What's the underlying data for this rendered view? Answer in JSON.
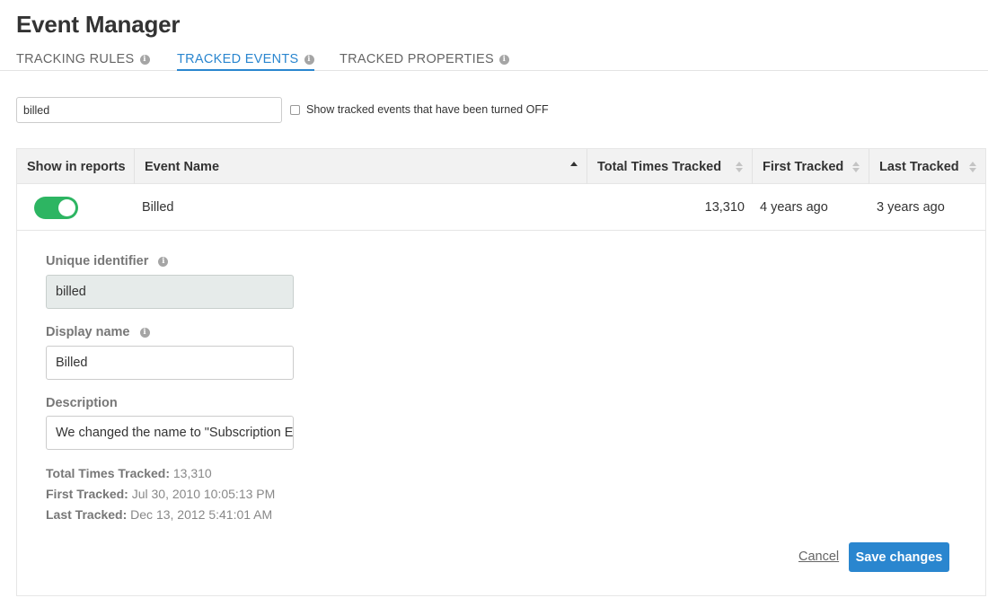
{
  "header": {
    "title": "Event Manager"
  },
  "tabs": [
    {
      "label": "TRACKING RULES",
      "active": false
    },
    {
      "label": "TRACKED EVENTS",
      "active": true
    },
    {
      "label": "TRACKED PROPERTIES",
      "active": false
    }
  ],
  "info_icon_glyph": "i",
  "filter": {
    "value": "billed",
    "show_off_label": "Show tracked events that have been turned OFF",
    "show_off_checked": false
  },
  "table": {
    "columns": [
      "Show in reports",
      "Event Name",
      "Total Times Tracked",
      "First Tracked",
      "Last Tracked"
    ],
    "sort": {
      "column": "Event Name",
      "direction": "ascending"
    },
    "rows": [
      {
        "show_in_reports": true,
        "event_name": "Billed",
        "total_times_tracked": "13,310",
        "first_tracked": "4 years ago",
        "last_tracked": "3 years ago"
      }
    ]
  },
  "detail": {
    "unique_identifier_label": "Unique identifier",
    "unique_identifier_value": "billed",
    "display_name_label": "Display name",
    "display_name_value": "Billed",
    "description_label": "Description",
    "description_value": "We changed the name to \"Subscription E",
    "stats": [
      {
        "label": "Total Times Tracked:",
        "value": "13,310"
      },
      {
        "label": "First Tracked:",
        "value": "Jul 30, 2010 10:05:13 PM"
      },
      {
        "label": "Last Tracked:",
        "value": "Dec 13, 2012 5:41:01 AM"
      }
    ],
    "cancel_label": "Cancel",
    "save_label": "Save changes"
  },
  "colors": {
    "accent": "#2a86cf",
    "toggle_on": "#2db562",
    "header_bg": "#f2f2f2"
  }
}
